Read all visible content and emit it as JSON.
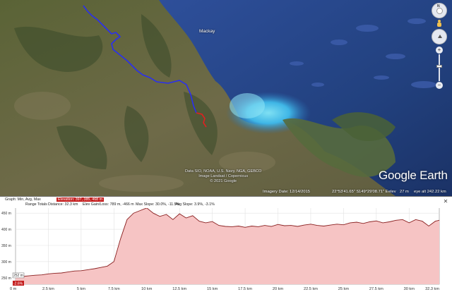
{
  "map": {
    "city_label": "Mackay",
    "attribution": [
      "Data SIO, NOAA, U.S. Navy, NGA, GEBCO",
      "Image Landsat / Copernicus",
      "© 2021 Google"
    ],
    "brand": "Google Earth",
    "status": {
      "imagery": "Imagery Date: 12/14/2015",
      "lat": "22°53'41.65\" S",
      "lon": "149°29'08.71\" E",
      "elev_label": "elev",
      "elev_value": "27 m",
      "eye_alt": "eye alt 242.22 km"
    },
    "controls": {
      "north_label": "N",
      "zoom_in": "+",
      "zoom_out": "−"
    }
  },
  "profile": {
    "header": {
      "graph_line": "Graph: Min, Avg, Max",
      "elevation_line": "Elevation: 397, 385, 468 m",
      "range_label": "Range Totals",
      "distance": "Distance: 32.3 km",
      "gain_loss": "Elev Gain/Loss: 789 m, -466 m",
      "max_slope": "Max Slope: 30.0%, -11.5%",
      "avg_slope": "Avg Slope: 3.9%, -3.1%"
    },
    "close_label": "✕",
    "fill_color": "#f6c4c4",
    "line_color": "#8a2020"
  },
  "chart_data": {
    "type": "area",
    "title": "",
    "xlabel": "",
    "ylabel": "",
    "xlim": [
      0,
      32.3
    ],
    "ylim": [
      230,
      470
    ],
    "y_ticks": [
      "450 m",
      "400 m",
      "350 m",
      "300 m",
      "250 m"
    ],
    "x_ticks": [
      "0 m",
      "2.5 km",
      "5 km",
      "7.5 km",
      "10 km",
      "12.5 km",
      "15 km",
      "17.5 km",
      "20 km",
      "22.5 km",
      "25 km",
      "27.5 km",
      "30 km",
      "32.3 km"
    ],
    "start_marker": {
      "value": "252 m",
      "slope": "-2.6%"
    },
    "series": [
      {
        "x": [
          0,
          0.5,
          1,
          1.5,
          2,
          2.5,
          3,
          3.5,
          4,
          4.5,
          5,
          5.5,
          6,
          6.5,
          7,
          7.5,
          8,
          8.5,
          9,
          9.5,
          10,
          10.5,
          11,
          11.5,
          12,
          12.5,
          13,
          13.5,
          14,
          14.5,
          15,
          15.5,
          16,
          16.5,
          17,
          17.5,
          18,
          18.5,
          19,
          19.5,
          20,
          20.5,
          21,
          21.5,
          22,
          22.5,
          23,
          23.5,
          24,
          24.5,
          25,
          25.5,
          26,
          26.5,
          27,
          27.5,
          28,
          28.5,
          29,
          29.5,
          30,
          30.5,
          31,
          31.5,
          32,
          32.3
        ],
        "y": [
          252,
          254,
          256,
          258,
          259,
          262,
          264,
          265,
          268,
          271,
          272,
          275,
          278,
          282,
          286,
          300,
          370,
          430,
          450,
          458,
          466,
          450,
          440,
          446,
          430,
          448,
          435,
          442,
          425,
          420,
          424,
          412,
          409,
          408,
          410,
          406,
          410,
          408,
          412,
          409,
          415,
          411,
          412,
          409,
          413,
          416,
          412,
          410,
          413,
          416,
          414,
          420,
          422,
          418,
          423,
          426,
          420,
          423,
          428,
          430,
          420,
          430,
          425,
          410,
          425,
          428
        ]
      }
    ],
    "grid": true
  }
}
